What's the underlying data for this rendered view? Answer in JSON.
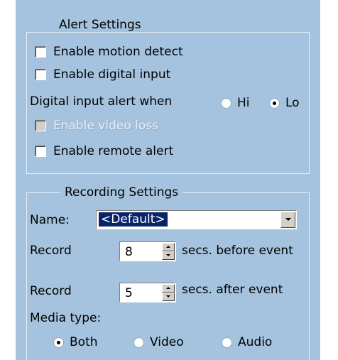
{
  "alert_settings": {
    "legend": "Alert Settings",
    "enable_motion_detect": {
      "label": "Enable motion detect",
      "checked": false
    },
    "enable_digital_input": {
      "label": "Enable digital input",
      "checked": false
    },
    "digital_input_alert_when": {
      "label": "Digital input alert when",
      "options": [
        "Hi",
        "Lo"
      ],
      "selected": "Lo"
    },
    "enable_video_loss": {
      "label": "Enable video loss",
      "checked": false,
      "enabled": false
    },
    "enable_remote_alert": {
      "label": "Enable remote alert",
      "checked": false
    }
  },
  "recording_settings": {
    "legend": "Recording Settings",
    "name_label": "Name:",
    "name_value": "<Default>",
    "record_before": {
      "label": "Record",
      "value": "8",
      "suffix": "secs. before event"
    },
    "record_after": {
      "label": "Record",
      "value": "5",
      "suffix": "secs. after event"
    },
    "media_type": {
      "label": "Media type:",
      "options": [
        "Both",
        "Video",
        "Audio"
      ],
      "selected": "Both"
    }
  },
  "colors": {
    "panel_background": "#a5c3de",
    "selection_highlight": "#0a246a"
  }
}
